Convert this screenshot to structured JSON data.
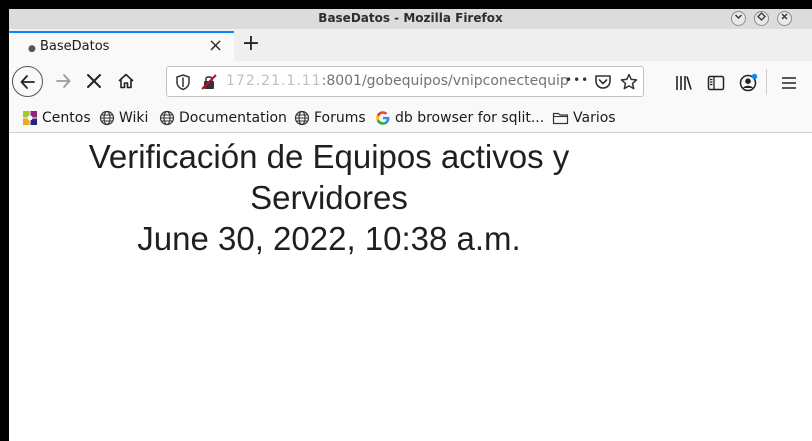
{
  "window": {
    "title": "BaseDatos - Mozilla Firefox"
  },
  "tab": {
    "label": "BaseDatos",
    "close_glyph": "×",
    "new_tab_glyph": "+"
  },
  "urlbar": {
    "host_masked": "172.21.1.11",
    "url_rest": ":8001/gobequipos/vnipconectequip",
    "more_glyph": "•••"
  },
  "bookmarks": [
    {
      "label": "Centos",
      "icon": "centos-icon"
    },
    {
      "label": "Wiki",
      "icon": "globe-icon"
    },
    {
      "label": "Documentation",
      "icon": "globe-icon"
    },
    {
      "label": "Forums",
      "icon": "globe-icon"
    },
    {
      "label": "db browser for sqlit...",
      "icon": "google-icon"
    },
    {
      "label": "Varios",
      "icon": "folder-icon"
    }
  ],
  "page": {
    "heading_line1": "Verificación de Equipos activos y",
    "heading_line2": "Servidores",
    "heading_line3": "June 30, 2022, 10:38 a.m."
  },
  "colors": {
    "accent": "#0a84ff",
    "chrome": "#f9f9fa",
    "titlebar": "#dcdcdc"
  }
}
